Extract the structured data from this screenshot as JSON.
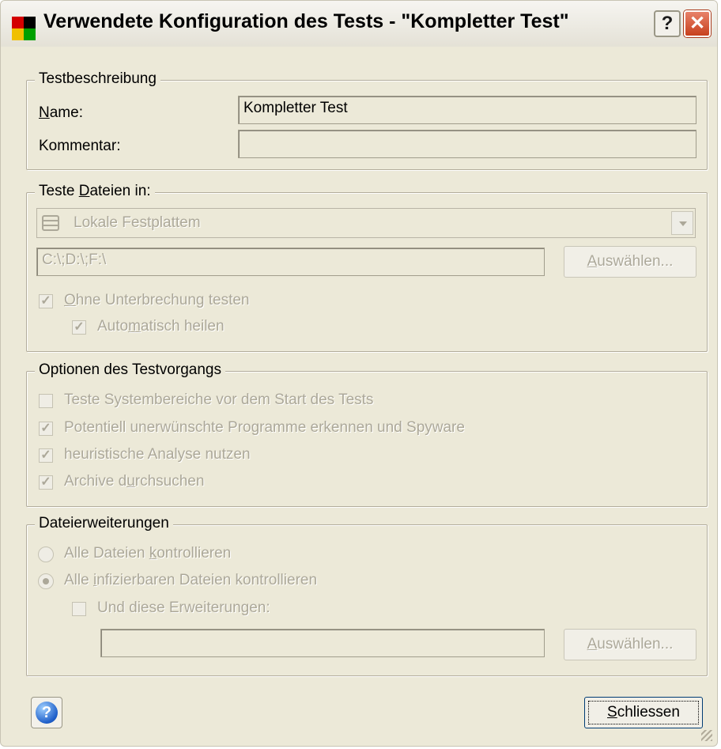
{
  "window": {
    "title": "Verwendete Konfiguration des Tests - \"Kompletter Test\"",
    "help_button": "?",
    "close_button": "✕"
  },
  "description": {
    "legend": "Testbeschreibung",
    "name_label": "Name:",
    "name_value": "Kompletter Test",
    "comment_label": "Kommentar:",
    "comment_value": ""
  },
  "scan_files": {
    "legend": "Teste Dateien in:",
    "drive_select": "Lokale Festplattem",
    "path_value": "C:\\;D:\\;F:\\",
    "choose_button": "Auswählen...",
    "nonstop_label": "Ohne Unterbrechung testen",
    "nonstop_checked": true,
    "autoheal_label": "Automatisch heilen",
    "autoheal_checked": true
  },
  "options": {
    "legend": "Optionen des Testvorgangs",
    "items": [
      {
        "label": "Teste Systembereiche vor dem Start des Tests",
        "checked": false
      },
      {
        "label": "Potentiell unerwünschte Programme erkennen und Spyware",
        "checked": true
      },
      {
        "label": "heuristische Analyse nutzen",
        "checked": true
      },
      {
        "label": "Archive durchsuchen",
        "checked": true
      }
    ]
  },
  "extensions": {
    "legend": "Dateierweiterungen",
    "all_files_label": "Alle Dateien kontrollieren",
    "all_files_selected": false,
    "infectable_label": "Alle infizierbaren Dateien kontrollieren",
    "infectable_selected": true,
    "these_ext_label": "Und diese Erweiterungen:",
    "these_ext_checked": false,
    "ext_value": "",
    "choose_button": "Auswählen..."
  },
  "footer": {
    "help_icon": "?",
    "close_label": "Schliessen"
  },
  "colors": {
    "dialog_bg": "#ece9d8",
    "disabled_text": "#aca899",
    "close_red": "#c7401d"
  }
}
